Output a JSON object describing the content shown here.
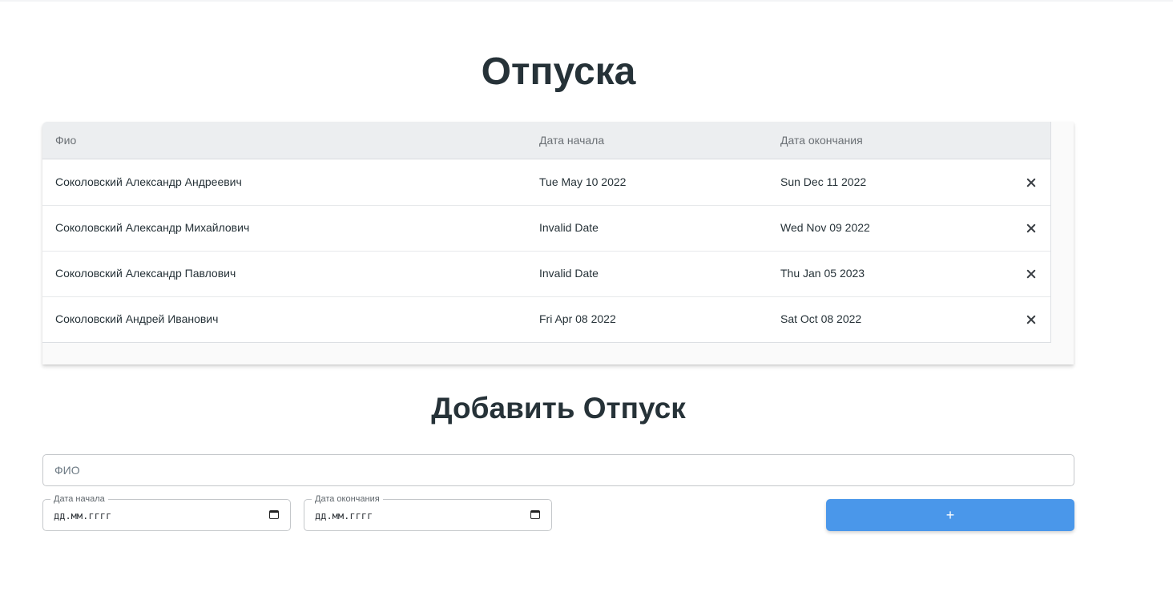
{
  "page": {
    "title": "Отпуска"
  },
  "table": {
    "headers": {
      "name": "Фио",
      "start": "Дата начала",
      "end": "Дата окончания"
    },
    "rows": [
      {
        "name": "Соколовский Александр Андреевич",
        "start": "Tue May 10 2022",
        "end": "Sun Dec 11 2022"
      },
      {
        "name": "Соколовский Александр Михайлович",
        "start": "Invalid Date",
        "end": "Wed Nov 09 2022"
      },
      {
        "name": "Соколовский Александр Павлович",
        "start": "Invalid Date",
        "end": "Thu Jan 05 2023"
      },
      {
        "name": "Соколовский Андрей Иванович",
        "start": "Fri Apr 08 2022",
        "end": "Sat Oct 08 2022"
      }
    ],
    "delete_icon": "close-icon"
  },
  "form": {
    "title": "Добавить Отпуск",
    "name_placeholder": "ФИО",
    "name_value": "",
    "start_label": "Дата начала",
    "start_value": "дд.мм.гггг",
    "end_label": "Дата окончания",
    "end_value": "дд.мм.гггг",
    "calendar_icon": "calendar-icon",
    "add_label": "+"
  },
  "colors": {
    "accent": "#4a97ea",
    "text": "#263238",
    "header_bg": "#eceef0"
  }
}
